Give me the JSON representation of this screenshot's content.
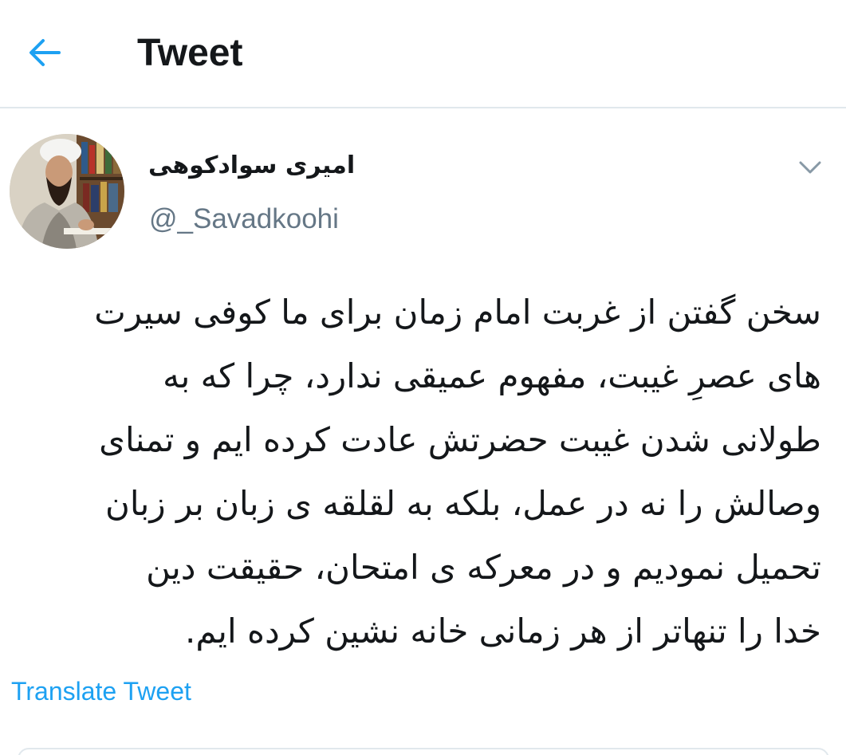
{
  "header": {
    "back_icon": "arrow-left-icon",
    "title": "Tweet"
  },
  "tweet": {
    "author": {
      "display_name": "امیری سوادکوهی",
      "handle": "@_Savadkoohi",
      "avatar": "avatar-photo"
    },
    "menu_icon": "chevron-down-icon",
    "text_lines": [
      "سخن گفتن از غربت امام زمان برای ما کوفی سیرت",
      "های عصرِ غیبت، مفهوم عمیقی ندارد، چرا که به",
      "طولانی شدن غیبت حضرتش عادت کرده ایم و تمنای",
      "وصالش را نه در عمل، بلکه به لقلقه ی زبان بر زبان",
      "تحمیل نمودیم و در معرکه ی امتحان، حقیقت دین",
      "خدا را تنهاتر از هر زمانی خانه نشین کرده ایم."
    ],
    "translate_label": "Translate Tweet"
  },
  "colors": {
    "accent": "#1da1f2",
    "text": "#14171a",
    "secondary": "#657786",
    "border": "#e1e8ed"
  }
}
